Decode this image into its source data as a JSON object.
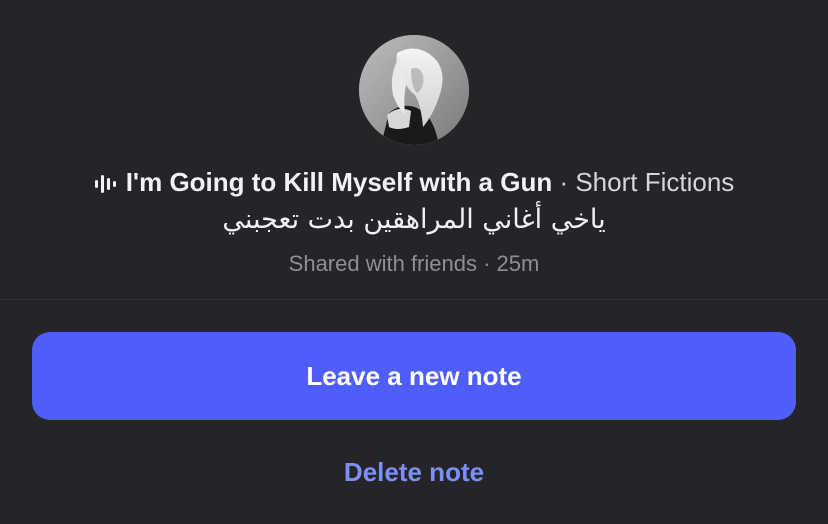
{
  "note": {
    "song_title": "I'm Going to Kill Myself with a Gun",
    "song_separator": " · ",
    "song_artist": "Short Fictions",
    "text": "ياخي أغاني المراهقين بدت تعجبني",
    "audience": "Shared with friends",
    "meta_separator": " · ",
    "time_ago": "25m"
  },
  "actions": {
    "primary_label": "Leave a new note",
    "secondary_label": "Delete note"
  },
  "icons": {
    "audio": "audio-wave-icon",
    "avatar": "avatar"
  },
  "colors": {
    "background": "#242429",
    "primary_button": "#4f5ef8",
    "secondary_text": "#7e8ff2",
    "muted_text": "#8e8e96"
  }
}
